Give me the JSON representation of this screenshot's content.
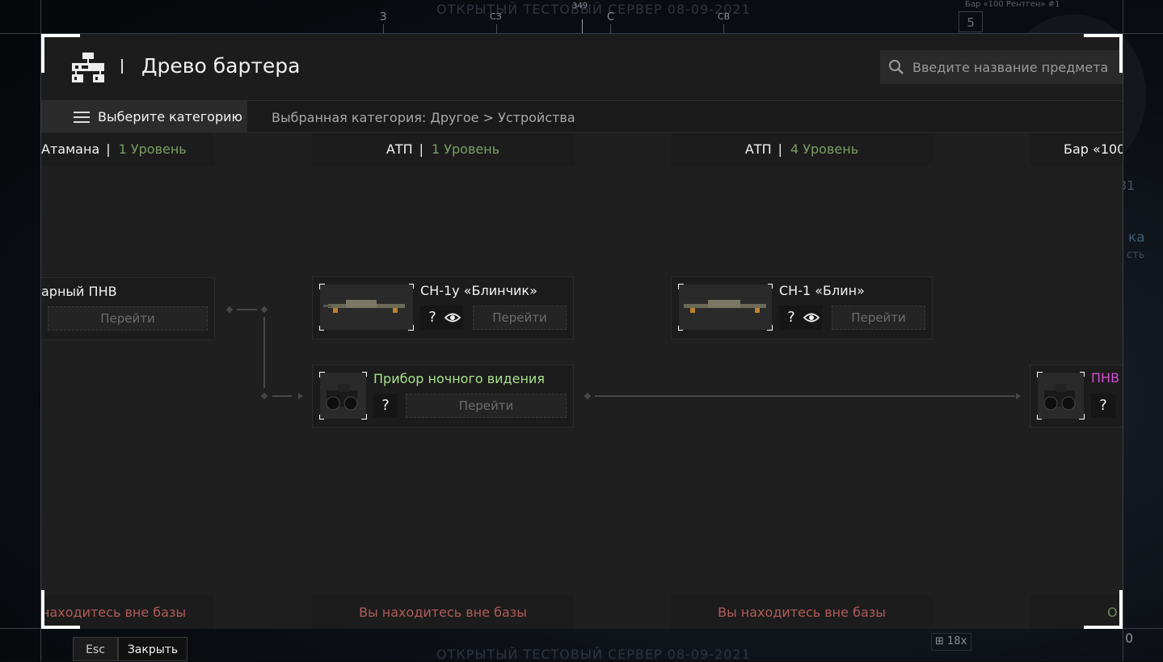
{
  "background": {
    "server_banner": "ОТКРЫТЫЙ ТЕСТОВЫЙ СЕРВЕР 08-09-2021",
    "compass": {
      "labels": [
        "З",
        "СЗ",
        "С",
        "СВ"
      ],
      "heading": "349"
    },
    "hud": {
      "top_right_label": "Бар «100 Рентген» #1",
      "badge": "5",
      "num": "31",
      "txt1": "ка",
      "txt2": "сть",
      "zoom": "18x",
      "counter": "0"
    }
  },
  "modal": {
    "title": "Древо бартера",
    "search": {
      "placeholder": "Введите название предмета",
      "value": ""
    },
    "category_button": "Выберите категорию",
    "breadcrumb": "Выбранная категория: Другое > Устройства",
    "columns": [
      {
        "trader": "Атамана",
        "level": "1 Уровень",
        "footer": "находитесь вне базы",
        "cards": [
          {
            "name": "арный ПНВ",
            "goto": "Перейти"
          }
        ]
      },
      {
        "trader": "АТП",
        "level": "1 Уровень",
        "footer": "Вы находитесь вне базы",
        "cards": [
          {
            "name": "СН-1у «Блинчик»",
            "q": "?",
            "goto": "Перейти"
          },
          {
            "name": "Прибор ночного видения",
            "q": "?",
            "goto": "Перейти"
          }
        ]
      },
      {
        "trader": "АТП",
        "level": "4 Уровень",
        "footer": "Вы находитесь вне базы",
        "cards": [
          {
            "name": "СН-1 «Блин»",
            "q": "?",
            "goto": "Перейти"
          }
        ]
      },
      {
        "trader": "Бар «100",
        "level": "",
        "footer": "О",
        "cards": [
          {
            "name": "ПНВ",
            "q": "?"
          }
        ]
      }
    ]
  },
  "bottom": {
    "esc_label": "Esc",
    "close_label": "Закрыть"
  },
  "colors": {
    "level_green": "#7a9e64",
    "footer_red": "#b25a5a",
    "item_green": "#a8e08a",
    "item_pink": "#d24fd2"
  }
}
